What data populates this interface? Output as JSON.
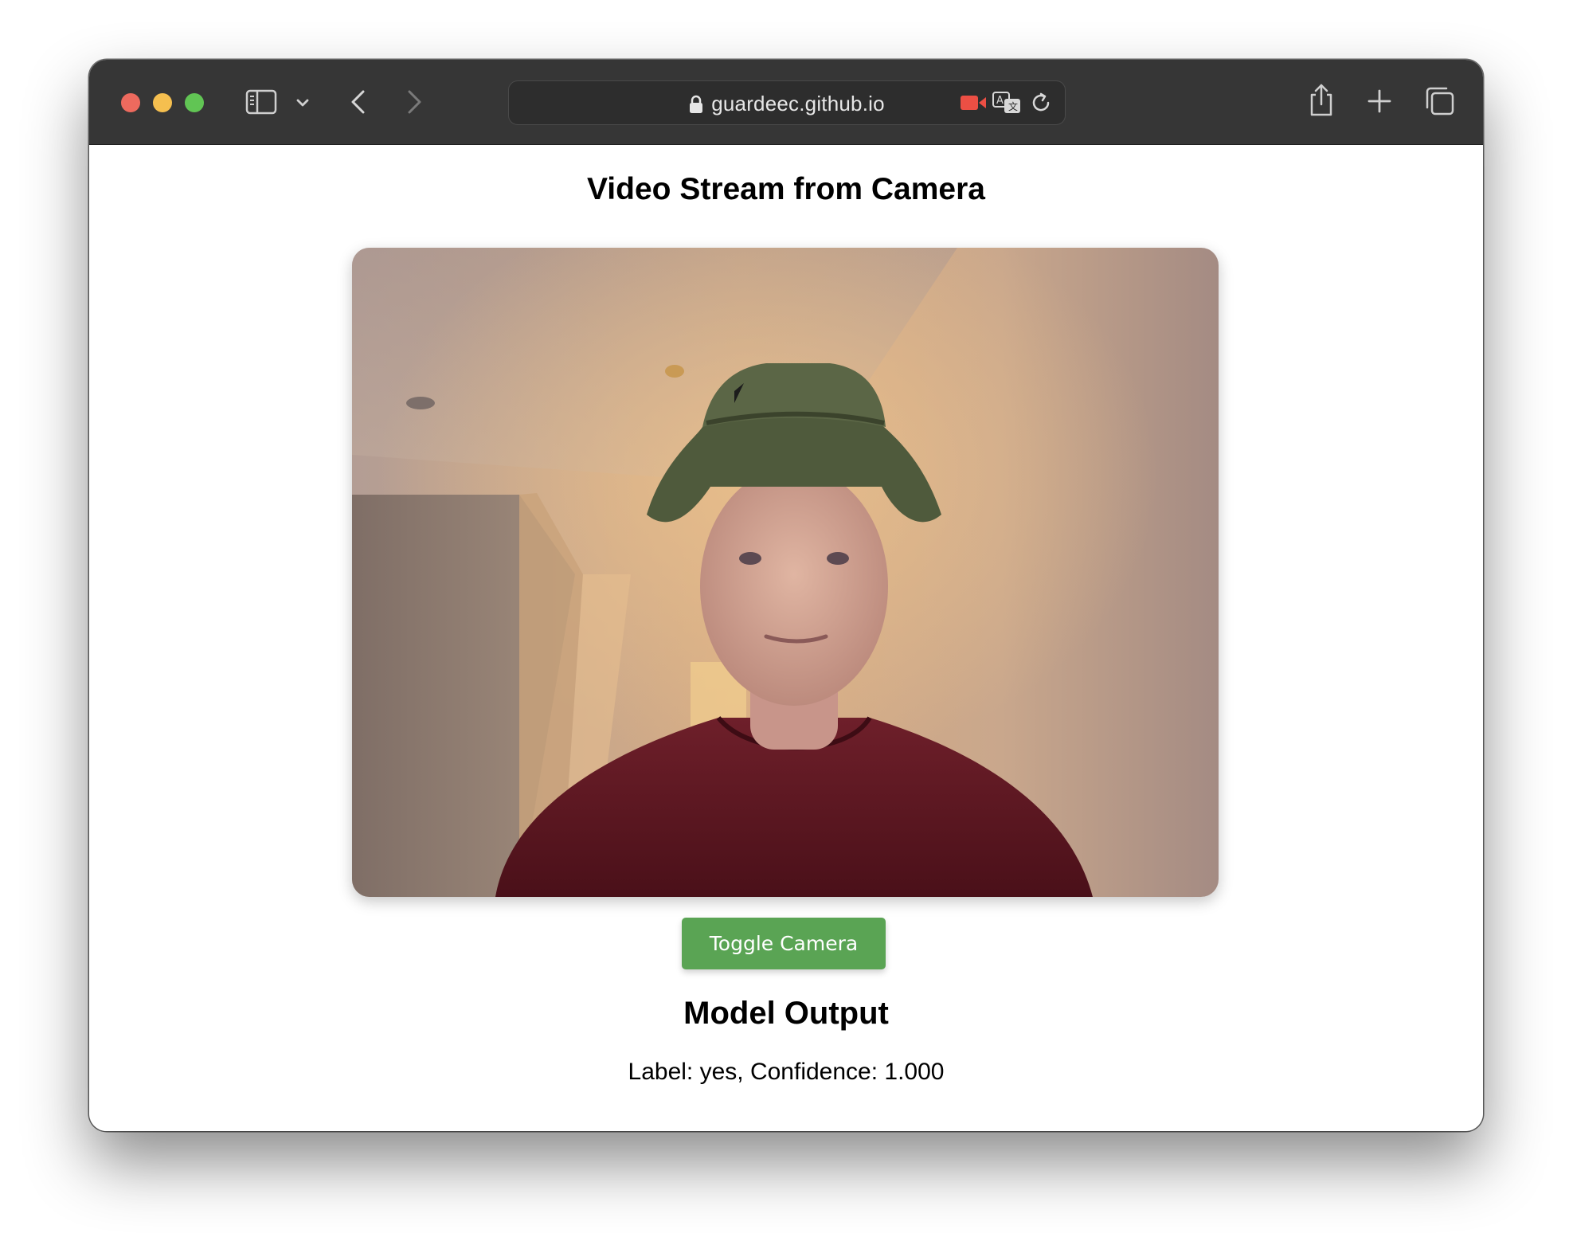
{
  "browser": {
    "url": "guardeec.github.io",
    "icons": [
      "close-icon",
      "minimize-icon",
      "zoom-icon",
      "sidebar-icon",
      "chevron-down-icon",
      "back-icon",
      "forward-icon",
      "lock-icon",
      "camera-recording-icon",
      "translate-icon",
      "reload-icon",
      "share-icon",
      "new-tab-icon",
      "tab-overview-icon"
    ]
  },
  "page": {
    "title": "Video Stream from Camera",
    "toggle_button": "Toggle Camera",
    "output_heading": "Model Output",
    "output_text": "Label: yes, Confidence: 1.000"
  },
  "colors": {
    "button": "#5aa454",
    "toolbar": "#363636"
  }
}
